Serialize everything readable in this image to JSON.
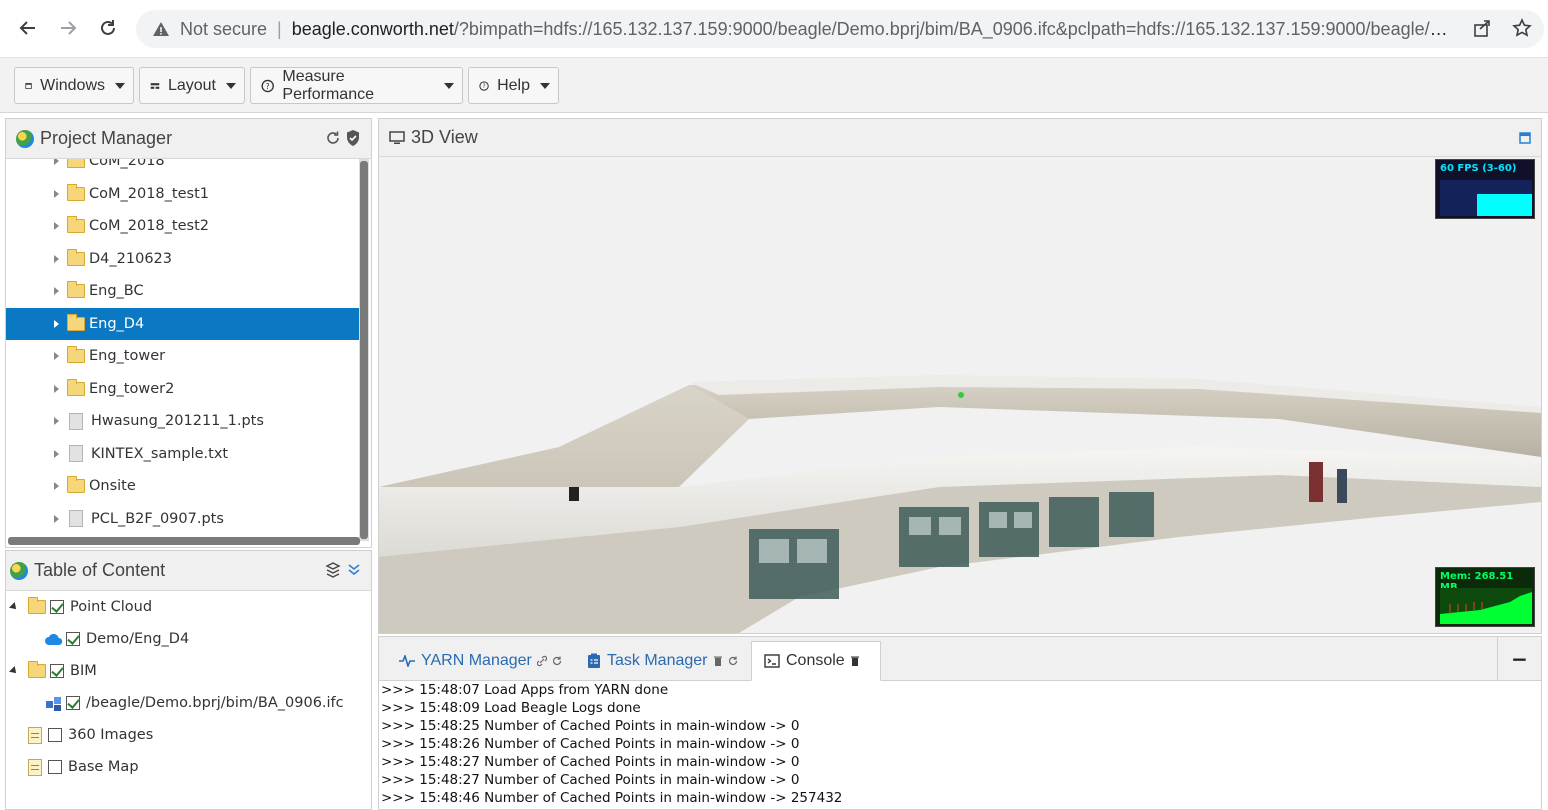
{
  "browser": {
    "security_label": "Not secure",
    "url_host": "beagle.conworth.net",
    "url_rest": "/?bimpath=hdfs://165.132.137.159:9000/beagle/Demo.bprj/bim/BA_0906.ifc&pclpath=hdfs://165.132.137.159:9000/beagle/Demo...."
  },
  "toolbar": {
    "windows_label": "Windows",
    "layout_label": "Layout",
    "measure_label": "Measure Performance",
    "help_label": "Help"
  },
  "project_manager": {
    "title": "Project Manager",
    "items": [
      {
        "label": "CoM_2018",
        "type": "folder",
        "selected": false
      },
      {
        "label": "CoM_2018_test1",
        "type": "folder",
        "selected": false
      },
      {
        "label": "CoM_2018_test2",
        "type": "folder",
        "selected": false
      },
      {
        "label": "D4_210623",
        "type": "folder",
        "selected": false
      },
      {
        "label": "Eng_BC",
        "type": "folder",
        "selected": false
      },
      {
        "label": "Eng_D4",
        "type": "folder",
        "selected": true
      },
      {
        "label": "Eng_tower",
        "type": "folder",
        "selected": false
      },
      {
        "label": "Eng_tower2",
        "type": "folder",
        "selected": false
      },
      {
        "label": "Hwasung_201211_1.pts",
        "type": "file",
        "selected": false
      },
      {
        "label": "KINTEX_sample.txt",
        "type": "file",
        "selected": false
      },
      {
        "label": "Onsite",
        "type": "folder",
        "selected": false
      },
      {
        "label": "PCL_B2F_0907.pts",
        "type": "file",
        "selected": false
      }
    ]
  },
  "toc": {
    "title": "Table of Content",
    "items": [
      {
        "label": "Point Cloud",
        "checked": true
      },
      {
        "label": "Demo/Eng_D4",
        "checked": true
      },
      {
        "label": "BIM",
        "checked": true
      },
      {
        "label": "/beagle/Demo.bprj/bim/BA_0906.ifc",
        "checked": true
      },
      {
        "label": "360 Images",
        "checked": false
      },
      {
        "label": "Base Map",
        "checked": false
      }
    ]
  },
  "view": {
    "title": "3D View",
    "fps_label": "60 FPS (3-60)",
    "fps_fraction": 0.6,
    "mem_label": "Mem: 268.51 MB"
  },
  "bottom": {
    "tabs": [
      {
        "label": "YARN Manager"
      },
      {
        "label": "Task Manager"
      },
      {
        "label": "Console"
      }
    ],
    "collapse_label": "−",
    "console_lines": [
      ">>> 15:48:07 Load Apps from YARN done",
      ">>> 15:48:09 Load Beagle Logs done",
      ">>> 15:48:25 Number of Cached Points in main-window -> 0",
      ">>> 15:48:26 Number of Cached Points in main-window -> 0",
      ">>> 15:48:27 Number of Cached Points in main-window -> 0",
      ">>> 15:48:27 Number of Cached Points in main-window -> 0",
      ">>> 15:48:46 Number of Cached Points in main-window -> 257432"
    ]
  },
  "colors": {
    "selection": "#0a78c2",
    "link_tab": "#2a6ab0",
    "fps_fill": "#00ffff",
    "mem_fill": "#00ff33"
  }
}
